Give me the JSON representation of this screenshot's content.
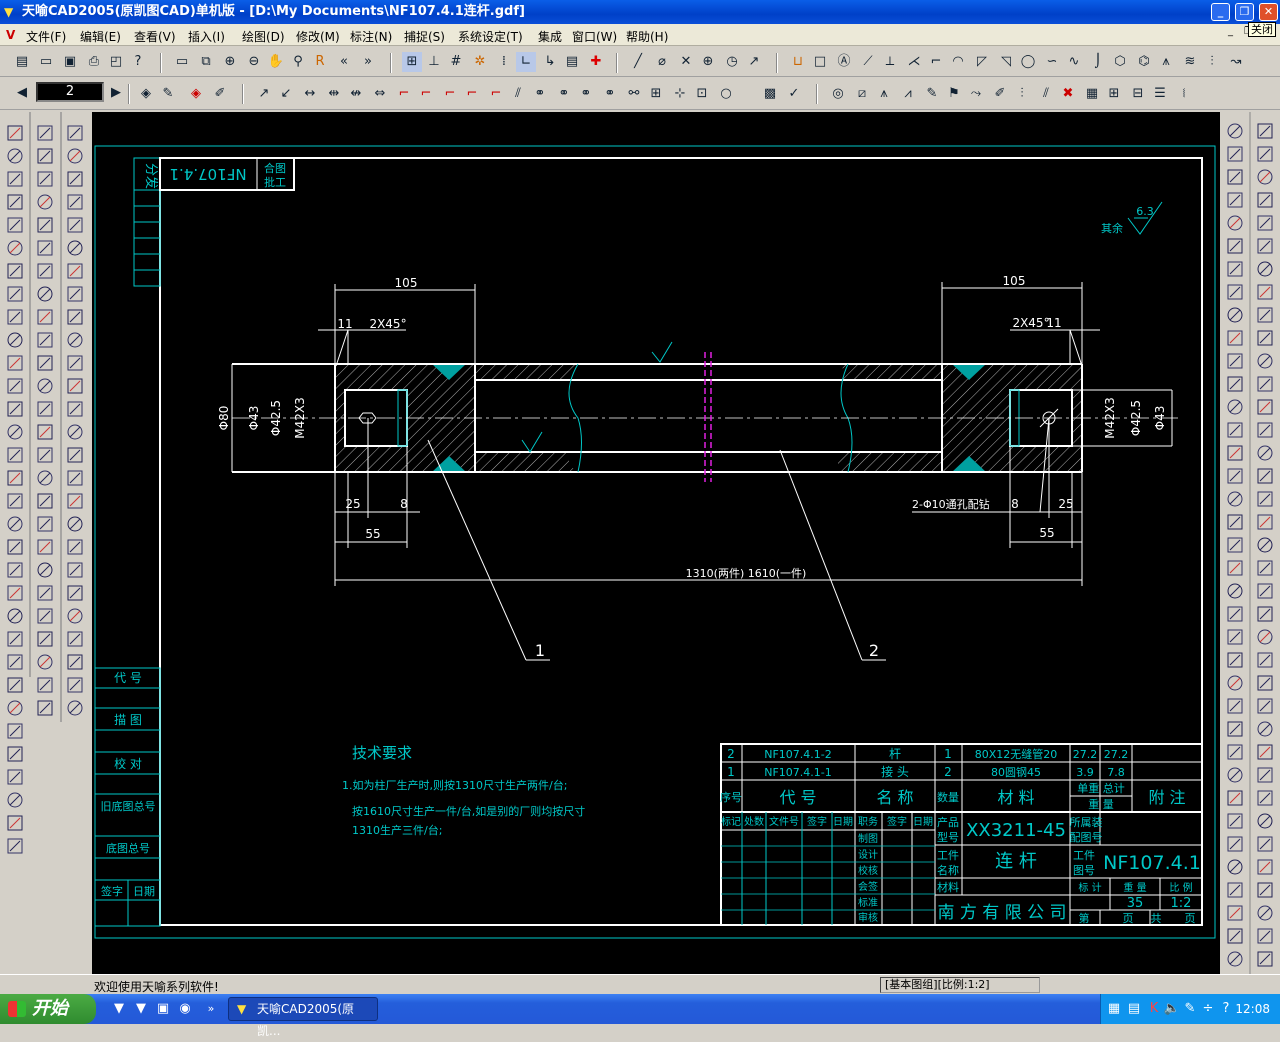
{
  "window": {
    "title": "天喻CAD2005(原凯图CAD)单机版 - [D:\\My Documents\\NF107.4.1连杆.gdf]",
    "close_tooltip": "关闭"
  },
  "menu": {
    "logo": "V",
    "items": [
      "文件(F)",
      "编辑(E)",
      "查看(V)",
      "插入(I)",
      "绘图(D)",
      "修改(M)",
      "标注(N)",
      "捕捉(S)",
      "系统设定(T)",
      "集成",
      "窗口(W)",
      "帮助(H)"
    ]
  },
  "layer": {
    "current": "2"
  },
  "drawing": {
    "side_block": {
      "label": "分发",
      "mirror_code": "NF107.4.1",
      "mirror_note": "合图",
      "mirror_note2": "批工"
    },
    "roughness": {
      "label": "其余",
      "value": "6.3"
    },
    "dims": {
      "d105_left": "105",
      "d105_right": "105",
      "d11_left": "11",
      "d11_right": "11",
      "chamfer_left": "2X45°",
      "chamfer_right": "2X45°",
      "phi80": "Φ80",
      "phi43_left": "Φ43",
      "phi43_right": "Φ43",
      "phi425_left": "Φ42.5",
      "phi425_right": "Φ42.5",
      "m42_left": "M42X3",
      "m42_right": "M42X3",
      "d25_left": "25",
      "d25_right": "25",
      "d8_left": "8",
      "d8_right": "8",
      "d55_left": "55",
      "d55_right": "55",
      "total": "1310(两件) 1610(一件)",
      "hole_note": "2-Φ10通孔配钻",
      "balloon1": "1",
      "balloon2": "2"
    },
    "tech_req": {
      "title": "技术要求",
      "line1": "1.如为柱厂生产时,则按1310尺寸生产两件/台;",
      "line2": "按1610尺寸生产一件/台,如是别的厂则均按尺寸",
      "line3": "1310生产三件/台;"
    },
    "left_box": [
      "代 号",
      "描 图",
      "校 对",
      "旧底图总号",
      "底图总号",
      "签字",
      "日期"
    ],
    "bom": [
      {
        "seq": "2",
        "code": "NF107.4.1-2",
        "name": "杆",
        "qty": "1",
        "material": "80X12无缝管20",
        "unit": "27.2",
        "total": "27.2"
      },
      {
        "seq": "1",
        "code": "NF107.4.1-1",
        "name": "接 头",
        "qty": "2",
        "material": "80圆钢45",
        "unit": "3.9",
        "total": "7.8"
      }
    ],
    "bom_header": {
      "seq": "序号",
      "code": "代 号",
      "name": "名 称",
      "qty": "数量",
      "material": "材 料",
      "weight": "单重 总计",
      "weight2": "重 量",
      "remark": "附 注"
    },
    "title_block": {
      "hdr": [
        "标记",
        "处数",
        "文件号",
        "签字",
        "日期",
        "职务",
        "签字",
        "日期"
      ],
      "roles": [
        "制图",
        "设计",
        "校核",
        "会签",
        "标准",
        "审核"
      ],
      "product_label": "产品",
      "model_label": "型号",
      "model": "XX3211-45",
      "assembly_label": "所属装",
      "assembly_label2": "配图号",
      "work_label": "工件",
      "name_label": "名称",
      "part_name": "连 杆",
      "drawing_label": "工件",
      "drawing_label2": "图号",
      "drawing_no": "NF107.4.1",
      "material_label": "材料",
      "mark_label": "标 计",
      "weight_label": "重 量",
      "scale_label": "比 例",
      "weight": "35",
      "scale": "1:2",
      "company": "南 方 有 限 公 司",
      "page_label": "第",
      "page_label2": "页",
      "of_label": "共",
      "of_label2": "页"
    }
  },
  "status": {
    "message": "欢迎使用天喻系列软件!",
    "panel": "[基本图组][比例:1:2]"
  },
  "taskbar": {
    "start": "开始",
    "item": "天喻CAD2005(原凯...",
    "clock": "12:08",
    "chevron": "»"
  }
}
